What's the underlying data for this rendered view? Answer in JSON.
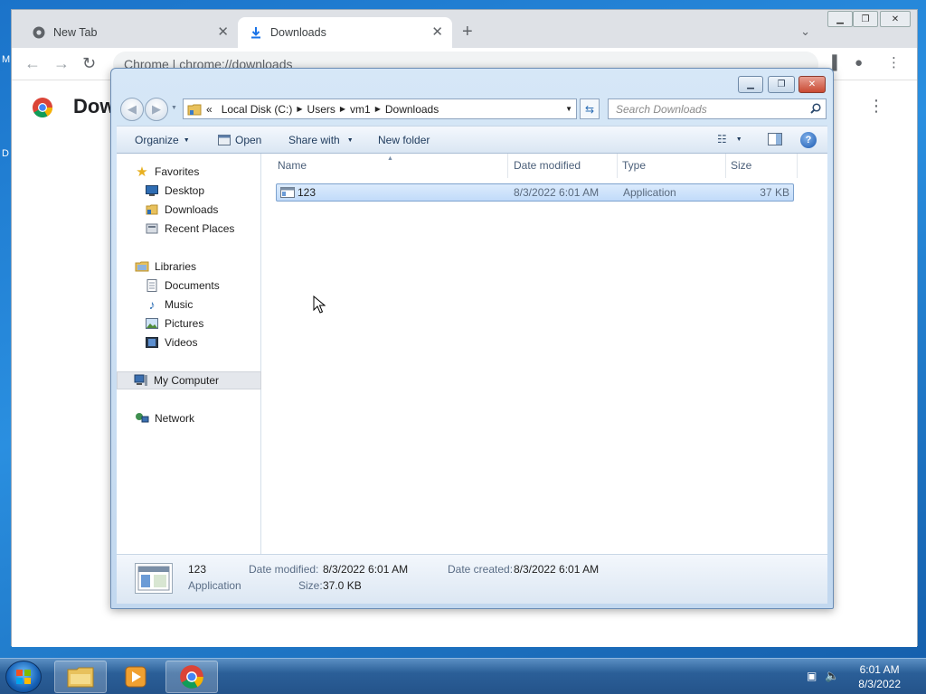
{
  "desktop": {
    "left_stub_1": "M",
    "left_stub_2": "D"
  },
  "chrome": {
    "tabs": [
      {
        "title": "New Tab",
        "icon": "chrome-icon"
      },
      {
        "title": "Downloads",
        "icon": "download-icon"
      }
    ],
    "omnibox_text": "Chrome  |  chrome://downloads",
    "page_title": "Dow"
  },
  "explorer": {
    "breadcrumb": {
      "overflow": "«",
      "items": [
        "Local Disk (C:)",
        "Users",
        "vm1",
        "Downloads"
      ]
    },
    "search_placeholder": "Search Downloads",
    "commands": {
      "organize": "Organize",
      "open": "Open",
      "share_with": "Share with",
      "new_folder": "New folder"
    },
    "nav": {
      "favorites": "Favorites",
      "desktop": "Desktop",
      "downloads": "Downloads",
      "recent_places": "Recent Places",
      "libraries": "Libraries",
      "documents": "Documents",
      "music": "Music",
      "pictures": "Pictures",
      "videos": "Videos",
      "my_computer": "My Computer",
      "network": "Network"
    },
    "columns": {
      "name": "Name",
      "date_modified": "Date modified",
      "type": "Type",
      "size": "Size"
    },
    "files": [
      {
        "name": "123",
        "date_modified": "8/3/2022 6:01 AM",
        "type": "Application",
        "size": "37 KB"
      }
    ],
    "details": {
      "name": "123",
      "type": "Application",
      "date_modified_label": "Date modified:",
      "date_modified": "8/3/2022 6:01 AM",
      "size_label": "Size:",
      "size": "37.0 KB",
      "date_created_label": "Date created:",
      "date_created": "8/3/2022 6:01 AM"
    }
  },
  "taskbar": {
    "time": "6:01 AM",
    "date": "8/3/2022"
  }
}
